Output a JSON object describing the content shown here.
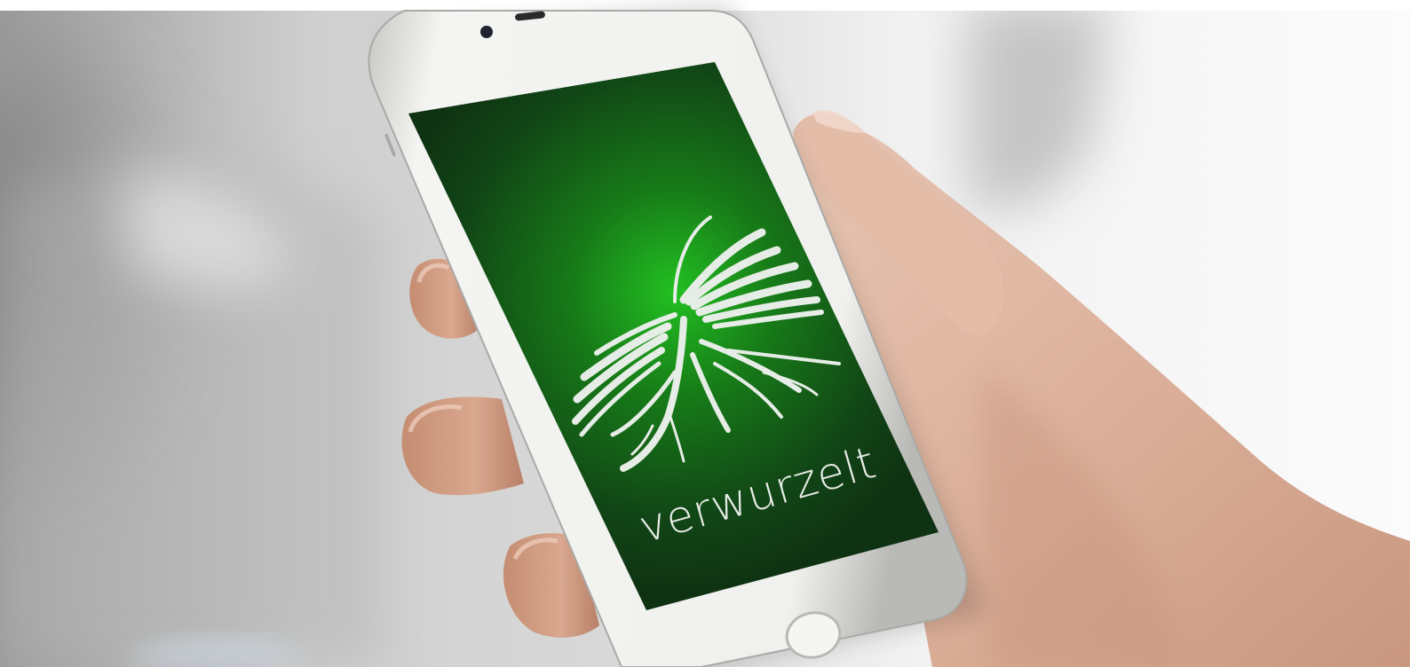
{
  "app": {
    "wordmark": "verwurzelt",
    "logo_icon": "book-roots-icon"
  },
  "colors": {
    "screen_dark": "#123a14",
    "screen_glow": "#1fb320",
    "logo_white": "#e6ece6",
    "phone_body": "#f1f1ef",
    "skin": "#ddb6a2",
    "background_light": "#f4f4f4",
    "background_shadow": "#8d8d8d"
  }
}
